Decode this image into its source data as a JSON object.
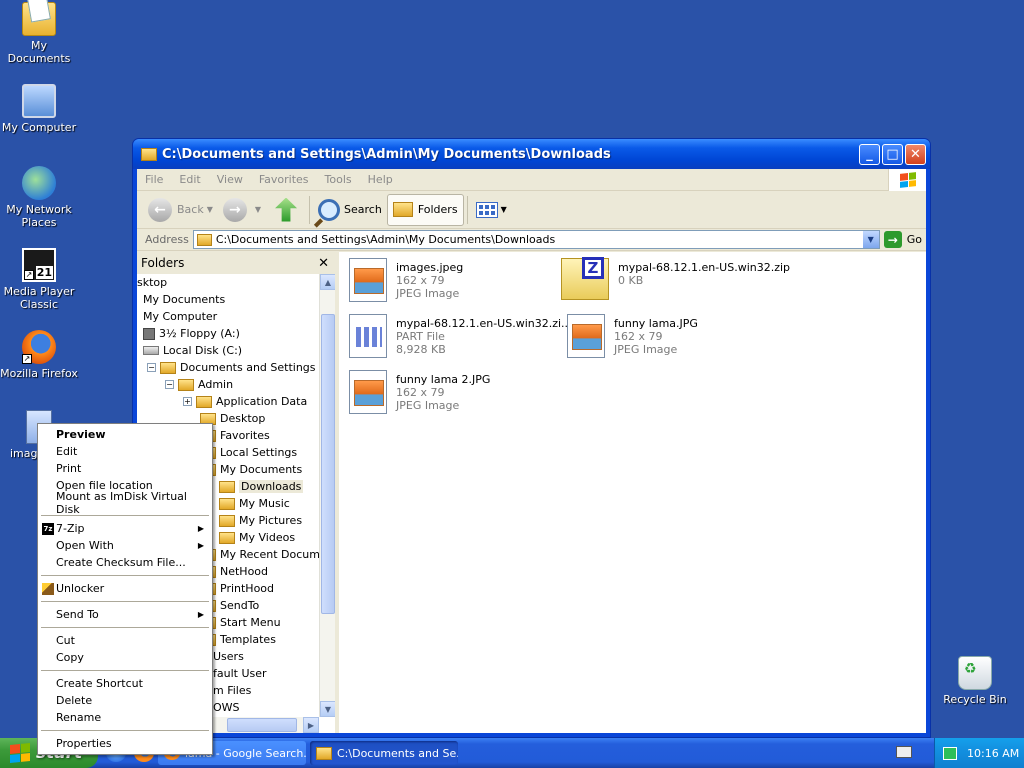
{
  "desktop": {
    "icons": [
      {
        "label": "My Documents"
      },
      {
        "label": "My Computer"
      },
      {
        "label": "My Network Places"
      },
      {
        "label": "Media Player Classic"
      },
      {
        "label": "Mozilla Firefox"
      },
      {
        "label": "image"
      },
      {
        "label": "Recycle Bin"
      }
    ]
  },
  "window": {
    "title": "C:\\Documents and Settings\\Admin\\My Documents\\Downloads",
    "controls": {
      "minimize": "_",
      "maximize": "□",
      "close": "✕"
    },
    "menu": [
      "File",
      "Edit",
      "View",
      "Favorites",
      "Tools",
      "Help"
    ],
    "toolbar": {
      "back": "Back",
      "search": "Search",
      "folders": "Folders"
    },
    "address": {
      "label": "Address",
      "value": "C:\\Documents and Settings\\Admin\\My Documents\\Downloads",
      "go": "Go"
    },
    "folders_pane": {
      "title": "Folders",
      "close": "✕",
      "tree": [
        {
          "label": "sktop"
        },
        {
          "label": "My Documents"
        },
        {
          "label": "My Computer"
        },
        {
          "label": "3½ Floppy (A:)"
        },
        {
          "label": "Local Disk (C:)"
        },
        {
          "label": "Documents and Settings"
        },
        {
          "label": "Admin"
        },
        {
          "label": "Application Data"
        },
        {
          "label": "Desktop"
        },
        {
          "label": "Favorites"
        },
        {
          "label": "Local Settings"
        },
        {
          "label": "My Documents"
        },
        {
          "label": "Downloads"
        },
        {
          "label": "My Music"
        },
        {
          "label": "My Pictures"
        },
        {
          "label": "My Videos"
        },
        {
          "label": "My Recent Document"
        },
        {
          "label": "NetHood"
        },
        {
          "label": "PrintHood"
        },
        {
          "label": "SendTo"
        },
        {
          "label": "Start Menu"
        },
        {
          "label": "Templates"
        },
        {
          "label": "Users"
        },
        {
          "label": "fault User"
        },
        {
          "label": "m Files"
        },
        {
          "label": "OWS"
        }
      ]
    },
    "files": [
      {
        "name": "images.jpeg",
        "line2": "162 x 79",
        "line3": "JPEG Image"
      },
      {
        "name": "mypal-68.12.1.en-US.win32.zip",
        "line2": "0 KB",
        "line3": ""
      },
      {
        "name": "mypal-68.12.1.en-US.win32.zi...",
        "line2": "PART File",
        "line3": "8,928 KB"
      },
      {
        "name": "funny lama.JPG",
        "line2": "162 x 79",
        "line3": "JPEG Image"
      },
      {
        "name": "funny lama 2.JPG",
        "line2": "162 x 79",
        "line3": "JPEG Image"
      }
    ]
  },
  "context_menu": {
    "items": [
      "Preview",
      "Edit",
      "Print",
      "Open file location",
      "Mount as ImDisk Virtual Disk",
      "7-Zip",
      "Open With",
      "Create Checksum File...",
      "Unlocker",
      "Send To",
      "Cut",
      "Copy",
      "Create Shortcut",
      "Delete",
      "Rename",
      "Properties"
    ],
    "badge_7zip": "7z"
  },
  "taskbar": {
    "start": "start",
    "tasks": [
      {
        "label": "lama - Google Search..."
      },
      {
        "label": "C:\\Documents and Se..."
      }
    ],
    "clock": "10:16 AM"
  }
}
